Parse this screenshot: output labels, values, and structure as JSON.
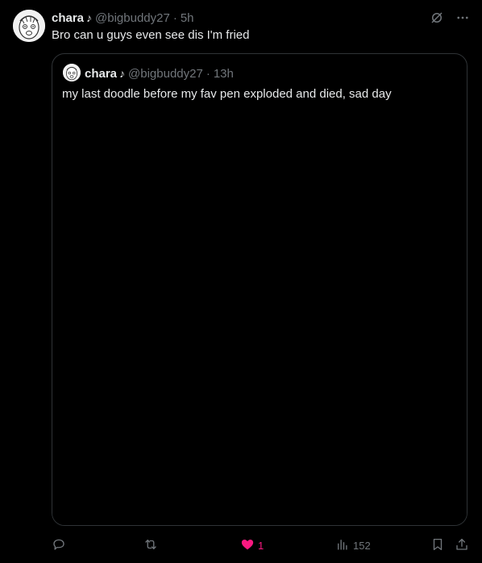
{
  "post": {
    "author_name": "chara",
    "author_note": "♪",
    "handle": "@bigbuddy27",
    "separator": "·",
    "time": "5h",
    "text": "Bro can u guys even see dis I'm fried"
  },
  "quoted": {
    "author_name": "chara",
    "author_note": "♪",
    "handle": "@bigbuddy27",
    "separator": "·",
    "time": "13h",
    "text": "my last doodle before my fav pen exploded and died, sad day"
  },
  "actions": {
    "reply_icon": "reply-icon",
    "repost_icon": "repost-icon",
    "like_icon": "heart-filled-icon",
    "like_count": "1",
    "views_icon": "views-icon",
    "views_count": "152",
    "bookmark_icon": "bookmark-icon",
    "share_icon": "share-icon"
  },
  "colors": {
    "background": "#000000",
    "text": "#e7e9ea",
    "muted": "#71767b",
    "border": "#2f3336",
    "like": "#f91880"
  }
}
